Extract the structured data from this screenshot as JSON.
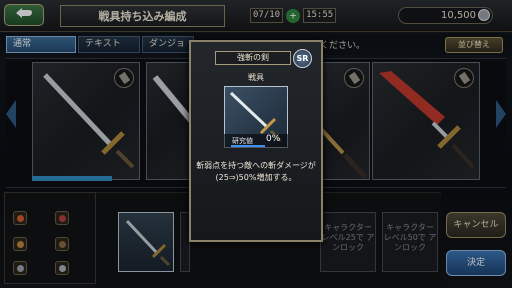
{
  "header": {
    "title": "戦具持ち込み編成",
    "date": "07/10",
    "time": "15:55",
    "money": "10,500"
  },
  "tabs": [
    {
      "label": "通常"
    },
    {
      "label": "テキスト"
    },
    {
      "label": "ダンジョ"
    }
  ],
  "info_text": "ください。",
  "sort_button": "並び替え",
  "popup": {
    "name": "強斬の剣",
    "rarity": "SR",
    "category": "戦具",
    "research_label": "研究値",
    "research_percent": "0%",
    "research_level": 0,
    "description_line1": "斬弱点を持つ敵への斬ダメージが",
    "description_line2": "(25⇒)50%増加する。"
  },
  "bottom_slots": [
    {
      "state": "filled",
      "text": ""
    },
    {
      "state": "filled",
      "text": ""
    },
    {
      "state": "filled",
      "text": ""
    },
    {
      "state": "locked",
      "text": "キャラクター レベル25で アンロック"
    },
    {
      "state": "locked",
      "text": "キャラクター レベル50で アンロック"
    }
  ],
  "buttons": {
    "cancel": "キャンセル",
    "confirm": "決定"
  },
  "colors": {
    "accent_blue": "#3b75b5",
    "gold_border": "#8b826b",
    "research_bar": "#3d8ff0"
  }
}
